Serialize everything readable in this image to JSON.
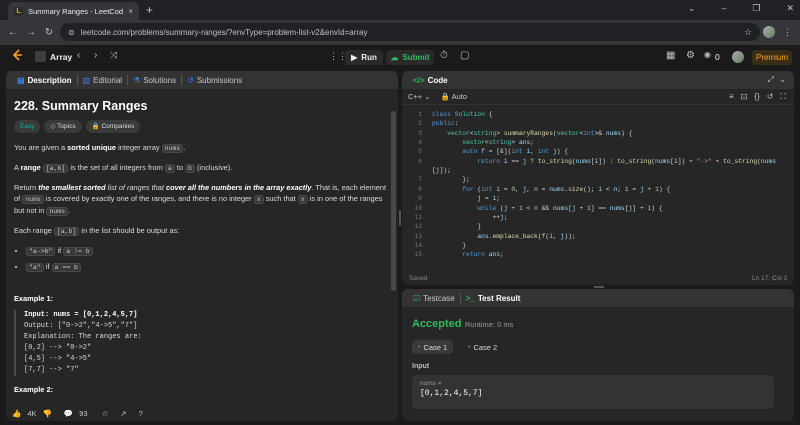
{
  "browser": {
    "tab_title": "Summary Ranges - LeetCode",
    "tab_close": "×",
    "new_tab": "+",
    "url": "leetcode.com/problems/summary-ranges/?envType=problem-list-v2&envId=array",
    "win_controls": [
      "⌄",
      "–",
      "❐",
      "✕"
    ]
  },
  "header": {
    "problem_list": "Array",
    "run": "Run",
    "submit": "Submit",
    "count": "0",
    "premium": "Premium"
  },
  "left_tabs": [
    "Description",
    "Editorial",
    "Solutions",
    "Submissions"
  ],
  "problem": {
    "title": "228. Summary Ranges",
    "tags": [
      "Easy",
      "Topics",
      "Companies"
    ],
    "p1_a": "You are given a ",
    "p1_b": "sorted unique",
    "p1_c": " integer array ",
    "p1_code": "nums",
    "p1_d": ".",
    "p2_a": "A ",
    "p2_b": "range",
    "p2_code1": "[a,b]",
    "p2_c": " is the set of all integers from ",
    "p2_code2": "a",
    "p2_d": " to ",
    "p2_code3": "b",
    "p2_e": " (inclusive).",
    "p3_a": "Return ",
    "p3_b": "the smallest sorted",
    "p3_c": " list of ranges that ",
    "p3_d": "cover all the numbers in the array exactly",
    "p3_e": ". That is, each element of ",
    "p3_code1": "nums",
    "p3_f": " is covered by exactly one of the ranges, and there is no integer ",
    "p3_code2": "x",
    "p3_g": " such that ",
    "p3_code3": "x",
    "p3_h": " is in one of the ranges but not in ",
    "p3_code4": "nums",
    "p3_i": ".",
    "p4_a": "Each range ",
    "p4_code": "[a,b]",
    "p4_b": " in the list should be output as:",
    "bullet1_code1": "\"a->b\"",
    "bullet1_a": " if ",
    "bullet1_code2": "a != b",
    "bullet2_code1": "\"a\"",
    "bullet2_a": " if ",
    "bullet2_code2": "a == b",
    "example1_title": "Example 1:",
    "example1_lines": [
      "Input: nums = [0,1,2,4,5,7]",
      "Output: [\"0->2\",\"4->5\",\"7\"]",
      "Explanation: The ranges are:",
      "[0,2] --> \"0->2\"",
      "[4,5] --> \"4->5\"",
      "[7,7] --> \"7\""
    ],
    "example2_title": "Example 2:"
  },
  "footer": {
    "likes": "4K",
    "comments": "93"
  },
  "code": {
    "tab": "Code",
    "language": "C++",
    "mode": "Auto",
    "status": "Saved",
    "cursor": "Ln 17, Col 3",
    "line_numbers": [
      "1",
      "2",
      "3",
      "4",
      "5",
      "6",
      "",
      "7",
      "8",
      "9",
      "10",
      "11",
      "12",
      "13",
      "14",
      "15"
    ]
  },
  "result": {
    "tabs": [
      "Testcase",
      "Test Result"
    ],
    "verdict": "Accepted",
    "runtime": "Runtime: 0 ms",
    "cases": [
      "Case 1",
      "Case 2"
    ],
    "input_label": "Input",
    "param_name": "nums =",
    "param_value": "[0,1,2,4,5,7]"
  }
}
